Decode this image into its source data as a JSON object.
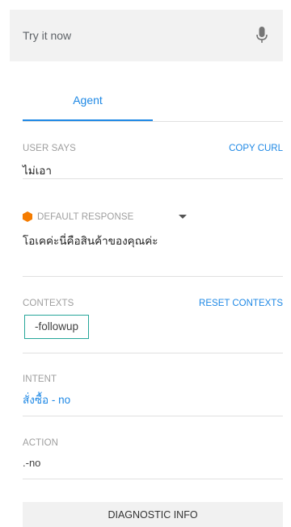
{
  "try": {
    "placeholder": "Try it now",
    "mic_icon": "microphone-icon"
  },
  "tabs": [
    {
      "label": "Agent"
    }
  ],
  "user_says": {
    "label": "USER SAYS",
    "copy_link": "COPY CURL",
    "value": "ไม่เอา"
  },
  "response": {
    "label": "DEFAULT RESPONSE",
    "icon": "hexagon-icon",
    "icon_color": "#f57c00",
    "value": "โอเคค่ะนี่คือสินค้าของคุณค่ะ"
  },
  "contexts": {
    "label": "CONTEXTS",
    "reset_link": "RESET CONTEXTS",
    "chips": [
      {
        "label": "-followup"
      }
    ]
  },
  "intent": {
    "label": "INTENT",
    "name": "สั่งซื้อ - no"
  },
  "action": {
    "label": "ACTION",
    "value": ".-no"
  },
  "diagnostic": {
    "label": "DIAGNOSTIC INFO"
  },
  "colors": {
    "accent": "#1e88e5",
    "chip_border": "#26a69a"
  }
}
